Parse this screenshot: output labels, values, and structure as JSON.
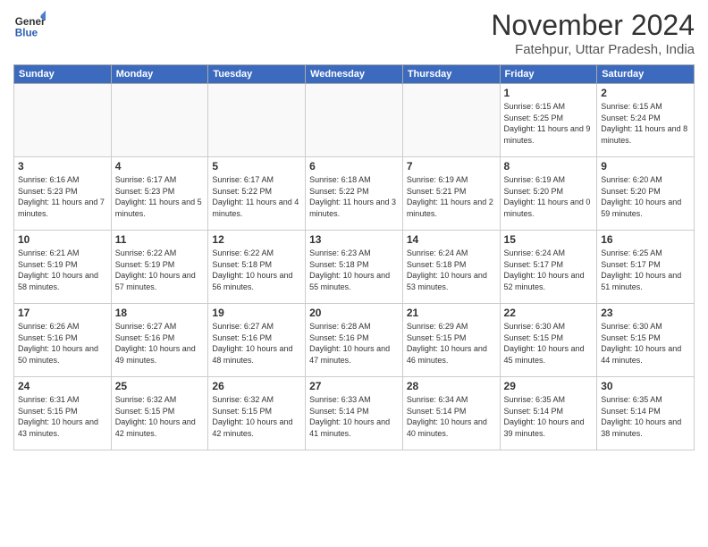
{
  "logo": {
    "name": "General",
    "name2": "Blue"
  },
  "title": "November 2024",
  "subtitle": "Fatehpur, Uttar Pradesh, India",
  "weekdays": [
    "Sunday",
    "Monday",
    "Tuesday",
    "Wednesday",
    "Thursday",
    "Friday",
    "Saturday"
  ],
  "weeks": [
    [
      {
        "day": "",
        "empty": true
      },
      {
        "day": "",
        "empty": true
      },
      {
        "day": "",
        "empty": true
      },
      {
        "day": "",
        "empty": true
      },
      {
        "day": "",
        "empty": true
      },
      {
        "day": "1",
        "sunrise": "6:15 AM",
        "sunset": "5:25 PM",
        "daylight": "11 hours and 9 minutes."
      },
      {
        "day": "2",
        "sunrise": "6:15 AM",
        "sunset": "5:24 PM",
        "daylight": "11 hours and 8 minutes."
      }
    ],
    [
      {
        "day": "3",
        "sunrise": "6:16 AM",
        "sunset": "5:23 PM",
        "daylight": "11 hours and 7 minutes."
      },
      {
        "day": "4",
        "sunrise": "6:17 AM",
        "sunset": "5:23 PM",
        "daylight": "11 hours and 5 minutes."
      },
      {
        "day": "5",
        "sunrise": "6:17 AM",
        "sunset": "5:22 PM",
        "daylight": "11 hours and 4 minutes."
      },
      {
        "day": "6",
        "sunrise": "6:18 AM",
        "sunset": "5:22 PM",
        "daylight": "11 hours and 3 minutes."
      },
      {
        "day": "7",
        "sunrise": "6:19 AM",
        "sunset": "5:21 PM",
        "daylight": "11 hours and 2 minutes."
      },
      {
        "day": "8",
        "sunrise": "6:19 AM",
        "sunset": "5:20 PM",
        "daylight": "11 hours and 0 minutes."
      },
      {
        "day": "9",
        "sunrise": "6:20 AM",
        "sunset": "5:20 PM",
        "daylight": "10 hours and 59 minutes."
      }
    ],
    [
      {
        "day": "10",
        "sunrise": "6:21 AM",
        "sunset": "5:19 PM",
        "daylight": "10 hours and 58 minutes."
      },
      {
        "day": "11",
        "sunrise": "6:22 AM",
        "sunset": "5:19 PM",
        "daylight": "10 hours and 57 minutes."
      },
      {
        "day": "12",
        "sunrise": "6:22 AM",
        "sunset": "5:18 PM",
        "daylight": "10 hours and 56 minutes."
      },
      {
        "day": "13",
        "sunrise": "6:23 AM",
        "sunset": "5:18 PM",
        "daylight": "10 hours and 55 minutes."
      },
      {
        "day": "14",
        "sunrise": "6:24 AM",
        "sunset": "5:18 PM",
        "daylight": "10 hours and 53 minutes."
      },
      {
        "day": "15",
        "sunrise": "6:24 AM",
        "sunset": "5:17 PM",
        "daylight": "10 hours and 52 minutes."
      },
      {
        "day": "16",
        "sunrise": "6:25 AM",
        "sunset": "5:17 PM",
        "daylight": "10 hours and 51 minutes."
      }
    ],
    [
      {
        "day": "17",
        "sunrise": "6:26 AM",
        "sunset": "5:16 PM",
        "daylight": "10 hours and 50 minutes."
      },
      {
        "day": "18",
        "sunrise": "6:27 AM",
        "sunset": "5:16 PM",
        "daylight": "10 hours and 49 minutes."
      },
      {
        "day": "19",
        "sunrise": "6:27 AM",
        "sunset": "5:16 PM",
        "daylight": "10 hours and 48 minutes."
      },
      {
        "day": "20",
        "sunrise": "6:28 AM",
        "sunset": "5:16 PM",
        "daylight": "10 hours and 47 minutes."
      },
      {
        "day": "21",
        "sunrise": "6:29 AM",
        "sunset": "5:15 PM",
        "daylight": "10 hours and 46 minutes."
      },
      {
        "day": "22",
        "sunrise": "6:30 AM",
        "sunset": "5:15 PM",
        "daylight": "10 hours and 45 minutes."
      },
      {
        "day": "23",
        "sunrise": "6:30 AM",
        "sunset": "5:15 PM",
        "daylight": "10 hours and 44 minutes."
      }
    ],
    [
      {
        "day": "24",
        "sunrise": "6:31 AM",
        "sunset": "5:15 PM",
        "daylight": "10 hours and 43 minutes."
      },
      {
        "day": "25",
        "sunrise": "6:32 AM",
        "sunset": "5:15 PM",
        "daylight": "10 hours and 42 minutes."
      },
      {
        "day": "26",
        "sunrise": "6:32 AM",
        "sunset": "5:15 PM",
        "daylight": "10 hours and 42 minutes."
      },
      {
        "day": "27",
        "sunrise": "6:33 AM",
        "sunset": "5:14 PM",
        "daylight": "10 hours and 41 minutes."
      },
      {
        "day": "28",
        "sunrise": "6:34 AM",
        "sunset": "5:14 PM",
        "daylight": "10 hours and 40 minutes."
      },
      {
        "day": "29",
        "sunrise": "6:35 AM",
        "sunset": "5:14 PM",
        "daylight": "10 hours and 39 minutes."
      },
      {
        "day": "30",
        "sunrise": "6:35 AM",
        "sunset": "5:14 PM",
        "daylight": "10 hours and 38 minutes."
      }
    ]
  ]
}
